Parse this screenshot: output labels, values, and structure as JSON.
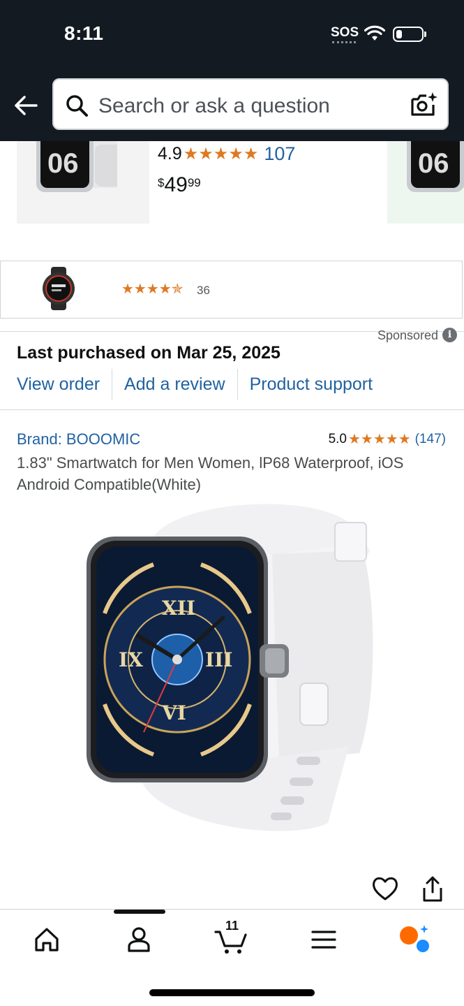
{
  "status_bar": {
    "time": "8:11",
    "sos": "SOS"
  },
  "header": {
    "search_placeholder": "Search or ask a question"
  },
  "carousel": {
    "rating": "4.9",
    "stars": "★★★★★",
    "review_count": "107",
    "price_symbol": "$",
    "price_whole": "49",
    "price_fraction": "99"
  },
  "sponsored_card": {
    "stars": "★★★★✯",
    "review_count": "36",
    "sponsored_label": "Sponsored",
    "info_glyph": "i"
  },
  "purchase": {
    "title": "Last purchased on Mar 25, 2025",
    "links": [
      "View order",
      "Add a review",
      "Product support"
    ]
  },
  "product": {
    "brand": "Brand: BOOOMIC",
    "rating": "5.0",
    "stars": "★★★★★",
    "review_count": "(147)",
    "title": "1.83\" Smartwatch for Men Women, lP68 Waterproof, iOS Android Compatible(White)"
  },
  "bottom_nav": {
    "items": [
      "home-icon",
      "account-icon",
      "cart-icon",
      "menu-icon",
      "rufus-icon"
    ],
    "cart_count": "11"
  },
  "colors": {
    "header_bg": "#131a22",
    "link": "#2162a1",
    "star": "#de7921",
    "rufus_orange": "#ff6a00",
    "rufus_blue": "#1a8cff"
  }
}
